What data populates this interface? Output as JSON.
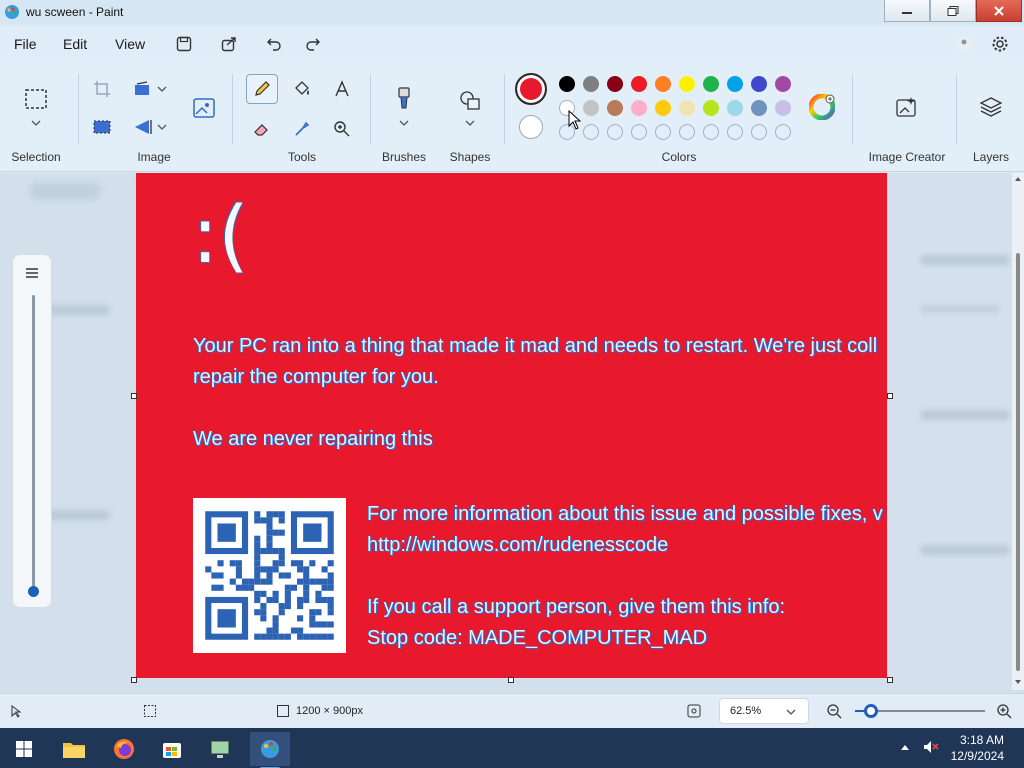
{
  "window": {
    "title": "wu scween - Paint"
  },
  "menu": {
    "file": "File",
    "edit": "Edit",
    "view": "View"
  },
  "ribbon": {
    "groups": {
      "selection": "Selection",
      "image": "Image",
      "tools": "Tools",
      "brushes": "Brushes",
      "shapes": "Shapes",
      "colors": "Colors",
      "image_creator": "Image Creator",
      "layers": "Layers"
    },
    "primary_color": "#e8192c",
    "secondary_color": "#ffffff",
    "palette_row1": [
      "#000000",
      "#7f7f7f",
      "#880015",
      "#ed1c24",
      "#ff7f27",
      "#fff200",
      "#22b14c",
      "#00a2e8",
      "#3f48cc",
      "#a349a4"
    ],
    "palette_row2": [
      "#ffffff",
      "#c3c3c3",
      "#b97a57",
      "#ffaec9",
      "#ffc90e",
      "#efe4b0",
      "#b5e61d",
      "#99d9ea",
      "#7092be",
      "#c8bfe7"
    ]
  },
  "canvas": {
    "sad_face": ":(",
    "line1": "Your PC ran into a thing that made it mad and needs to restart. We're just coll",
    "line2": "repair the computer for you.",
    "line3": "We are never repairing this",
    "info1": "For more information about this issue and possible fixes, v",
    "info2": "http://windows.com/rudenesscode",
    "info3": "If you call a support person, give them this info:",
    "info4": "Stop code: MADE_COMPUTER_MAD"
  },
  "status": {
    "dimensions": "1200 × 900px",
    "zoom": "62.5%",
    "zoom_slider_fraction": 0.12
  },
  "taskbar": {
    "time": "3:18 AM",
    "date": "12/9/2024"
  }
}
